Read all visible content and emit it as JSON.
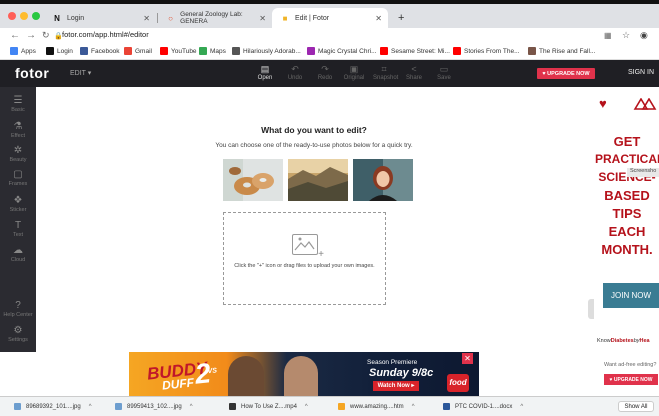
{
  "browser": {
    "tabs": [
      {
        "label": "Login",
        "favicon": "N"
      },
      {
        "label": "General Zoology Lab: GENERA",
        "favicon": "○"
      },
      {
        "label": "Edit | Fotor",
        "favicon": "■"
      }
    ],
    "new_tab": "+",
    "url": "fotor.com/app.html#/editor",
    "bookmarks": [
      {
        "label": "Apps",
        "color": "#4285f4"
      },
      {
        "label": "Login",
        "color": "#111111"
      },
      {
        "label": "Facebook",
        "color": "#3b5998"
      },
      {
        "label": "Gmail",
        "color": "#ea4335"
      },
      {
        "label": "YouTube",
        "color": "#ff0000"
      },
      {
        "label": "Maps",
        "color": "#34a853"
      },
      {
        "label": "Hilariously Adorab...",
        "color": "#555555"
      },
      {
        "label": "Magic Crystal Chri...",
        "color": "#9c27b0"
      },
      {
        "label": "Sesame Street: Mi...",
        "color": "#ff0000"
      },
      {
        "label": "Stories From The...",
        "color": "#ff0000"
      },
      {
        "label": "The Rise and Fall...",
        "color": "#795548"
      }
    ]
  },
  "fotor": {
    "logo": "fotor",
    "edit_menu": "EDIT ▾",
    "toolbar": [
      {
        "label": "Open",
        "icon": "open-icon"
      },
      {
        "label": "Undo",
        "icon": "undo-icon"
      },
      {
        "label": "Redo",
        "icon": "redo-icon"
      },
      {
        "label": "Original",
        "icon": "original-icon"
      },
      {
        "label": "Snapshot",
        "icon": "snapshot-icon"
      },
      {
        "label": "Share",
        "icon": "share-icon"
      },
      {
        "label": "Save",
        "icon": "save-icon"
      }
    ],
    "upgrade": "♥ UPGRADE NOW",
    "signin": "SIGN IN",
    "sidebar": [
      {
        "label": "Basic"
      },
      {
        "label": "Effect"
      },
      {
        "label": "Beauty"
      },
      {
        "label": "Frames"
      },
      {
        "label": "Sticker"
      },
      {
        "label": "Text"
      },
      {
        "label": "Cloud"
      }
    ],
    "sidebar_bottom": [
      {
        "label": "Help Center"
      },
      {
        "label": "Settings"
      }
    ],
    "main": {
      "question": "What do you want to edit?",
      "subtitle": "You can choose one of the ready-to-use photos below for a quick try.",
      "drop_text": "Click the \"+\" icon or drag files to upload your own images."
    }
  },
  "right_ad": {
    "lines": [
      "GET",
      "PRACTICAL",
      "SCIENCE-",
      "BASED",
      "TIPS",
      "EACH",
      "MONTH."
    ],
    "screenshot_badge": "Screensho",
    "join": "JOIN NOW",
    "brand_know": "Know",
    "brand_diabetes": "Diabetes",
    "brand_by": "by",
    "brand_heart": "Hea"
  },
  "banner": {
    "show_left": "BUDDY",
    "show_mid": "VS",
    "show_right": "DUFF",
    "show_num": "2",
    "premiere": "Season Premiere",
    "date": "Sunday 9/8c",
    "watch": "Watch Now ▸",
    "network": "food",
    "want_ad": "Want ad-free editing?",
    "upgrade": "♥ UPGRADE NOW"
  },
  "downloads": [
    {
      "name": "89689392_101....jpg"
    },
    {
      "name": "89959413_102....jpg"
    },
    {
      "name": "How To Use Z....mp4"
    },
    {
      "name": "www.amazing....htm"
    },
    {
      "name": "PTC COVID-1....docx"
    }
  ],
  "show_all": "Show All"
}
